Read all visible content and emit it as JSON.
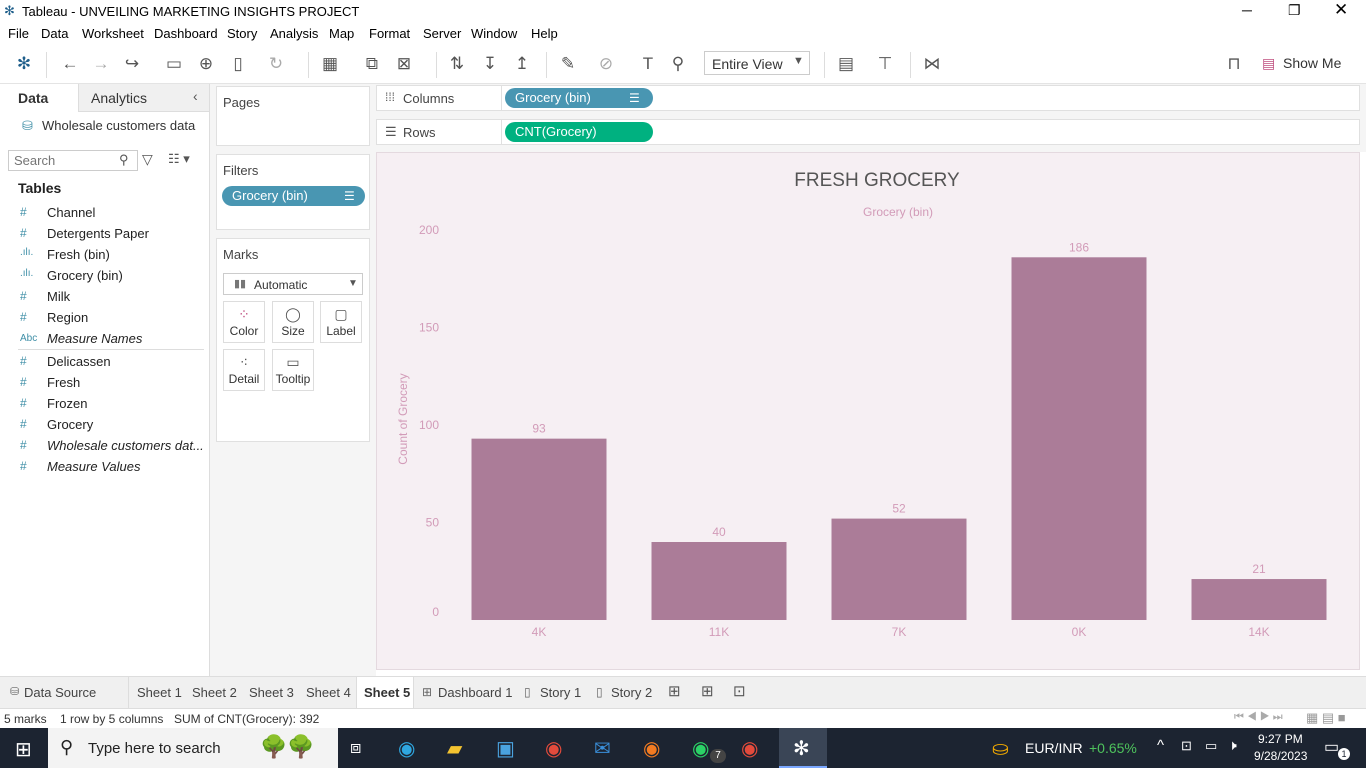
{
  "window": {
    "title": "Tableau - UNVEILING MARKETING INSIGHTS PROJECT"
  },
  "menu": [
    "File",
    "Data",
    "Worksheet",
    "Dashboard",
    "Story",
    "Analysis",
    "Map",
    "Format",
    "Server",
    "Window",
    "Help"
  ],
  "toolbar": {
    "view_select": "Entire View",
    "show_me": "Show Me"
  },
  "left_pane": {
    "tab_data": "Data",
    "tab_analytics": "Analytics",
    "datasource": "Wholesale customers data",
    "search_placeholder": "Search",
    "tables_header": "Tables",
    "fields": [
      {
        "icon": "#",
        "name": "Channel",
        "italic": false
      },
      {
        "icon": "#",
        "name": "Detergents Paper",
        "italic": false
      },
      {
        "icon": "bin",
        "name": "Fresh (bin)",
        "italic": false
      },
      {
        "icon": "bin",
        "name": "Grocery (bin)",
        "italic": false
      },
      {
        "icon": "#",
        "name": "Milk",
        "italic": false
      },
      {
        "icon": "#",
        "name": "Region",
        "italic": false
      },
      {
        "icon": "Abc",
        "name": "Measure Names",
        "italic": true
      },
      {
        "icon": "#",
        "name": "Delicassen",
        "italic": false
      },
      {
        "icon": "#",
        "name": "Fresh",
        "italic": false
      },
      {
        "icon": "#",
        "name": "Frozen",
        "italic": false
      },
      {
        "icon": "#",
        "name": "Grocery",
        "italic": false
      },
      {
        "icon": "#",
        "name": "Wholesale customers dat...",
        "italic": true
      },
      {
        "icon": "#",
        "name": "Measure Values",
        "italic": true
      }
    ]
  },
  "cards": {
    "pages": "Pages",
    "filters": "Filters",
    "filter_pill": "Grocery (bin)",
    "marks": "Marks",
    "mark_type": "Automatic",
    "buttons": [
      "Color",
      "Size",
      "Label",
      "Detail",
      "Tooltip"
    ]
  },
  "shelves": {
    "columns_label": "Columns",
    "columns_pill": "Grocery (bin)",
    "rows_label": "Rows",
    "rows_pill": "CNT(Grocery)"
  },
  "chart_data": {
    "type": "bar",
    "title": "FRESH GROCERY",
    "xlabel": "Grocery (bin)",
    "ylabel": "Count of Grocery",
    "categories": [
      "4K",
      "11K",
      "7K",
      "0K",
      "14K"
    ],
    "values": [
      93,
      40,
      52,
      186,
      21
    ],
    "ylim": [
      0,
      200
    ],
    "yticks": [
      0,
      50,
      100,
      150,
      200
    ],
    "bar_color": "#ab7c98",
    "label_color": "#d29bb8",
    "background": "#f6eff3"
  },
  "sheet_tabs": [
    "Data Source",
    "Sheet 1",
    "Sheet 2",
    "Sheet 3",
    "Sheet 4",
    "Sheet 5",
    "Dashboard 1",
    "Story 1",
    "Story 2"
  ],
  "active_tab": "Sheet 5",
  "status": {
    "marks": "5 marks",
    "rows_cols": "1 row by 5 columns",
    "sum": "SUM of CNT(Grocery): 392"
  },
  "taskbar": {
    "search_placeholder": "Type here to search",
    "currency": "EUR/INR",
    "change": "+0.65%",
    "time": "9:27 PM",
    "date": "9/28/2023",
    "whatsapp_badge": "7",
    "notif_badge": "1"
  }
}
